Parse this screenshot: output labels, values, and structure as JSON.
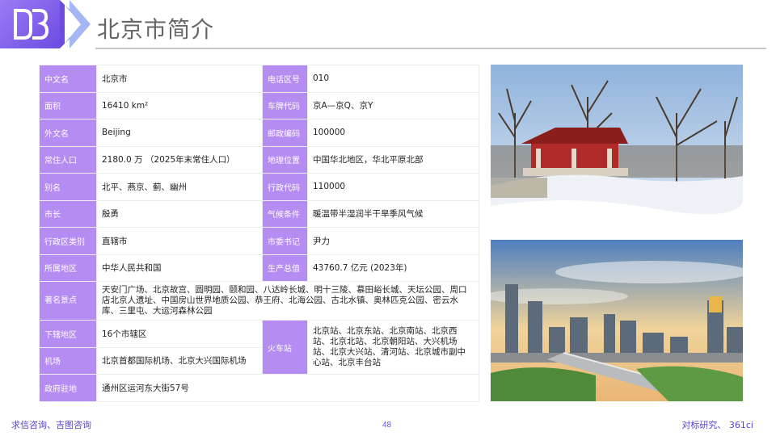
{
  "header": {
    "logo_icon": "db-logo-icon",
    "title": "北京市简介"
  },
  "table": {
    "rows": [
      {
        "k1": "中文名",
        "v1": "北京市",
        "k2": "电话区号",
        "v2": "010"
      },
      {
        "k1": "面积",
        "v1": "16410 km²",
        "k2": "车牌代码",
        "v2": "京A—京Q、京Y"
      },
      {
        "k1": "外文名",
        "v1": "Beijing",
        "k2": "邮政编码",
        "v2": "100000"
      },
      {
        "k1": "常住人口",
        "v1": "2180.0 万 （2025年末常住人口）",
        "k2": "地理位置",
        "v2": "中国华北地区，华北平原北部"
      },
      {
        "k1": "别名",
        "v1": "北平、燕京、蓟、幽州",
        "k2": "行政代码",
        "v2": "110000"
      },
      {
        "k1": "市长",
        "v1": "殷勇",
        "k2": "气候条件",
        "v2": "暖温带半湿润半干旱季风气候"
      },
      {
        "k1": "行政区类别",
        "v1": "直辖市",
        "k2": "市委书记",
        "v2": "尹力"
      },
      {
        "k1": "所属地区",
        "v1": "中华人民共和国",
        "k2": "生产总值",
        "v2": "43760.7 亿元 (2023年)"
      }
    ],
    "scenic_key": "著名景点",
    "scenic_value": "天安门广场、北京故宫、圆明园、颐和园、八达岭长城、明十三陵、慕田峪长城、天坛公园、周口店北京人遗址、中国房山世界地质公园、恭王府、北海公园、古北水镇、奥林匹克公园、密云水库、三里屯、大运河森林公园",
    "district_key": "下辖地区",
    "district_value": "16个市辖区",
    "airport_key": "机场",
    "airport_value": "北京首都国际机场、北京大兴国际机场",
    "train_key": "火车站",
    "train_value": "北京站、北京东站、北京南站、北京西站、北京北站、北京朝阳站、大兴机场站、北京大兴站、清河站、北京城市副中心站、北京丰台站",
    "gov_key": "政府驻地",
    "gov_value": "通州区运河东大街57号"
  },
  "photos": {
    "top": "pavilion-winter-photo",
    "bottom": "beijing-skyline-photo"
  },
  "footer": {
    "left": "求信咨询、吉图咨询",
    "page": "48",
    "right": "对标研究、 361ci"
  },
  "colors": {
    "accent": "#b48cf2",
    "brand_dark": "#6c4ce0",
    "footer_text": "#5a3fd6"
  }
}
